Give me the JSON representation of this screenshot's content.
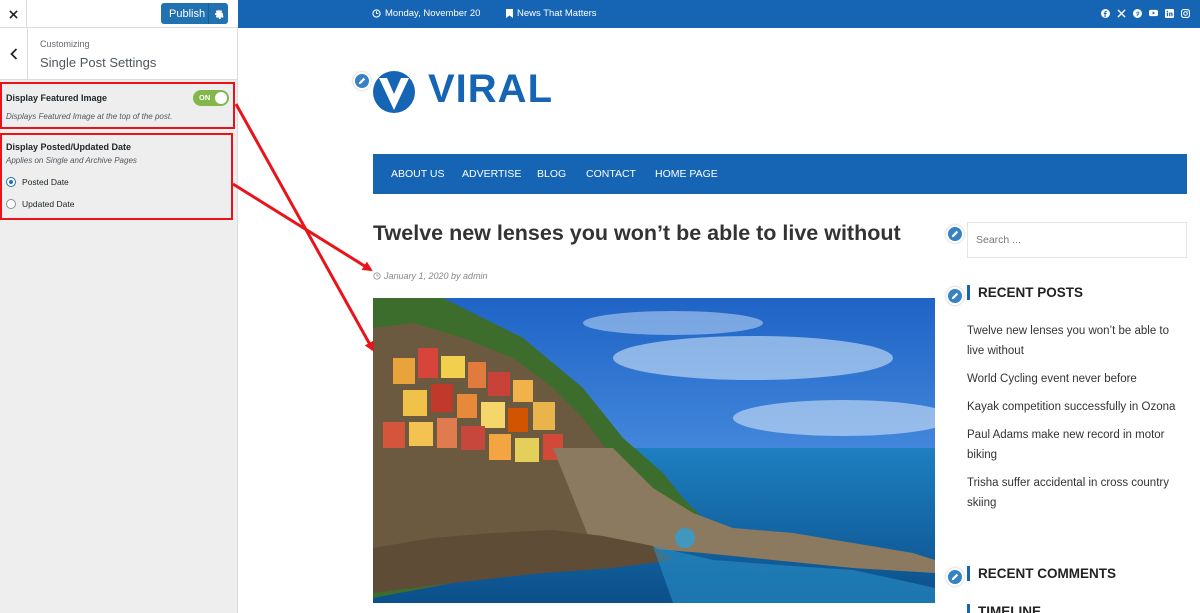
{
  "customizer": {
    "publish_label": "Publish",
    "breadcrumb": "Customizing",
    "section_title": "Single Post Settings",
    "featured_image": {
      "label": "Display Featured Image",
      "toggle_text": "ON",
      "description": "Displays Featured Image at the top of the post."
    },
    "date_setting": {
      "label": "Display Posted/Updated Date",
      "description": "Applies on Single and Archive Pages",
      "options": [
        "Posted Date",
        "Updated Date"
      ],
      "selected": "Posted Date"
    }
  },
  "topbar": {
    "date": "Monday, November 20",
    "tagline": "News That Matters",
    "social_icons": [
      "facebook-icon",
      "x-icon",
      "pinterest-icon",
      "youtube-icon",
      "linkedin-icon",
      "instagram-icon"
    ]
  },
  "site": {
    "logo_text": "VIRAL",
    "nav": [
      "ABOUT US",
      "ADVERTISE",
      "BLOG",
      "CONTACT",
      "HOME PAGE"
    ]
  },
  "post": {
    "title": "Twelve new lenses you won’t be able to live without",
    "meta": "January 1, 2020 by admin"
  },
  "sidebar": {
    "search_placeholder": "Search ...",
    "recent_posts_title": "RECENT POSTS",
    "recent_posts": [
      "Twelve new lenses you won’t be able to live without",
      "World Cycling event never before",
      "Kayak competition successfully in Ozona",
      "Paul Adams make new record in motor biking",
      "Trisha suffer accidental in cross country skiing"
    ],
    "recent_comments_title": "RECENT COMMENTS",
    "next_title_partial": "TIMELINE"
  },
  "colors": {
    "brand_blue": "#1565b4",
    "highlight_red": "#e8141a",
    "toggle_green": "#84b64c"
  }
}
